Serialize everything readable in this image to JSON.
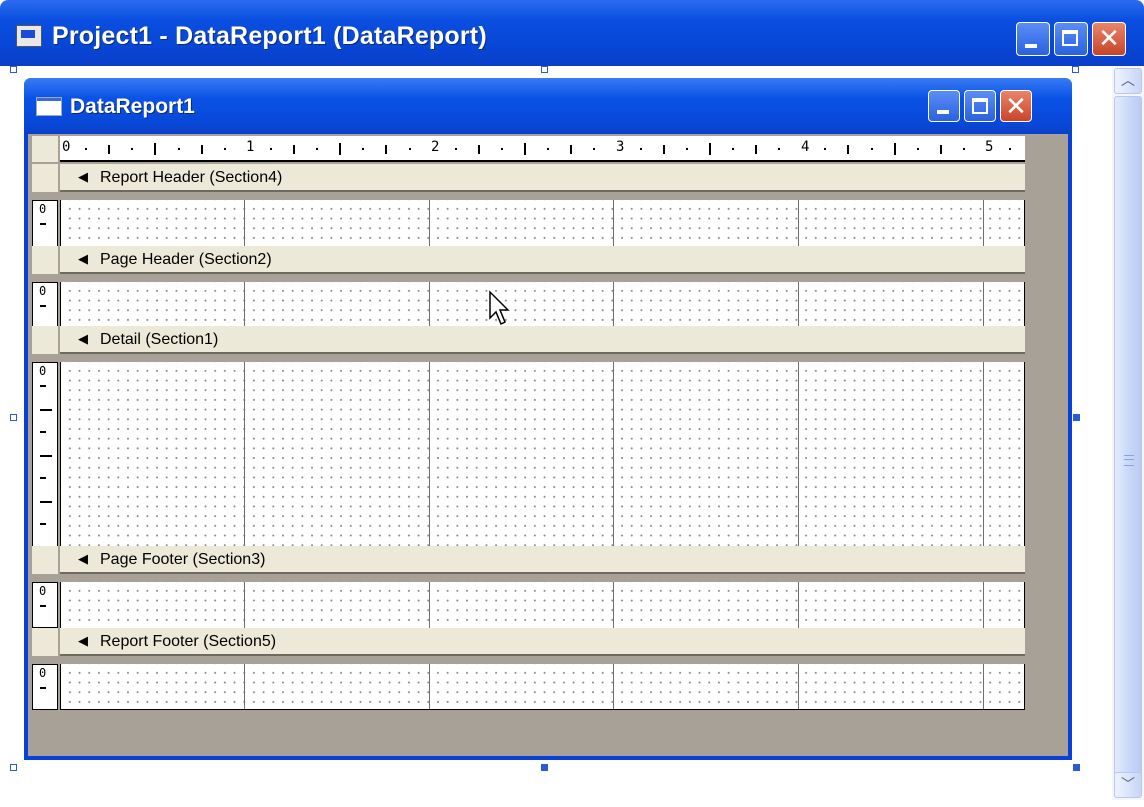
{
  "outer_window": {
    "title": "Project1 - DataReport1 (DataReport)",
    "buttons": {
      "minimize": "minimize",
      "maximize": "maximize",
      "close": "close"
    }
  },
  "inner_window": {
    "title": "DataReport1"
  },
  "ruler": {
    "labels": [
      "0",
      "1",
      "2",
      "3",
      "4",
      "5"
    ]
  },
  "sections": [
    {
      "label": "Report Header (Section4)",
      "ruler_zero": "0"
    },
    {
      "label": "Page Header (Section2)",
      "ruler_zero": "0"
    },
    {
      "label": "Detail (Section1)",
      "ruler_zero": "0"
    },
    {
      "label": "Page Footer (Section3)",
      "ruler_zero": "0"
    },
    {
      "label": "Report Footer (Section5)",
      "ruler_zero": "0"
    }
  ],
  "colors": {
    "titlebar": "#0a4fe0",
    "client_bg": "#a7a198",
    "section_bar": "#ece9d8",
    "close_button": "#c8442a"
  },
  "icons": {
    "app": "vb-project-icon",
    "document": "report-window-icon",
    "section_arrow": "arrow-left-icon",
    "cursor": "mouse-pointer-icon"
  }
}
